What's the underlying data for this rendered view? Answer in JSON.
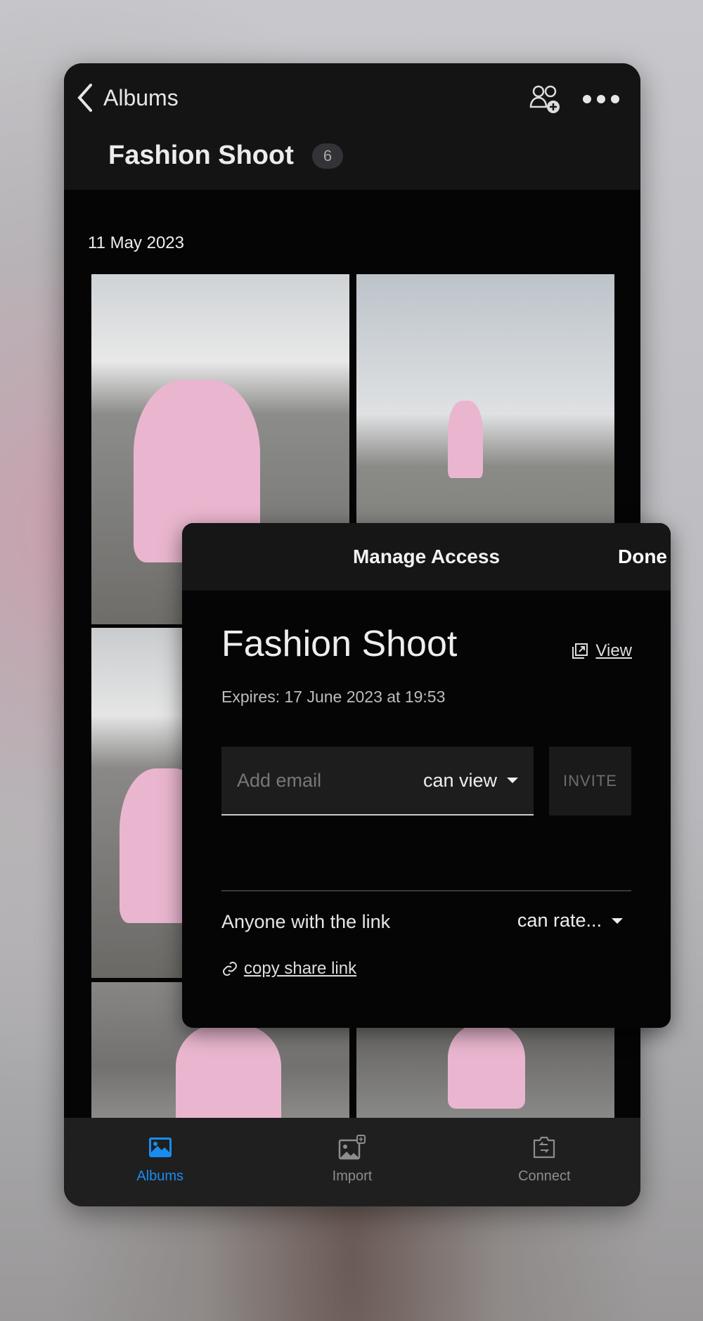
{
  "header": {
    "back_label": "Albums",
    "album_title": "Fashion Shoot",
    "photo_count": "6"
  },
  "date_group": "11 May 2023",
  "tabbar": {
    "accent": "#1a8cf0",
    "items": [
      {
        "label": "Albums",
        "active": true
      },
      {
        "label": "Import"
      },
      {
        "label": "Connect"
      }
    ]
  },
  "modal": {
    "title": "Manage Access",
    "done_label": "Done",
    "album_name": "Fashion Shoot",
    "view_label": "View",
    "expires": "Expires: 17 June 2023 at 19:53",
    "email_placeholder": "Add email",
    "permission": "can view",
    "invite_label": "INVITE",
    "link_audience": "Anyone with the link",
    "link_permission": "can rate...",
    "copy_link_label": "copy share link"
  }
}
